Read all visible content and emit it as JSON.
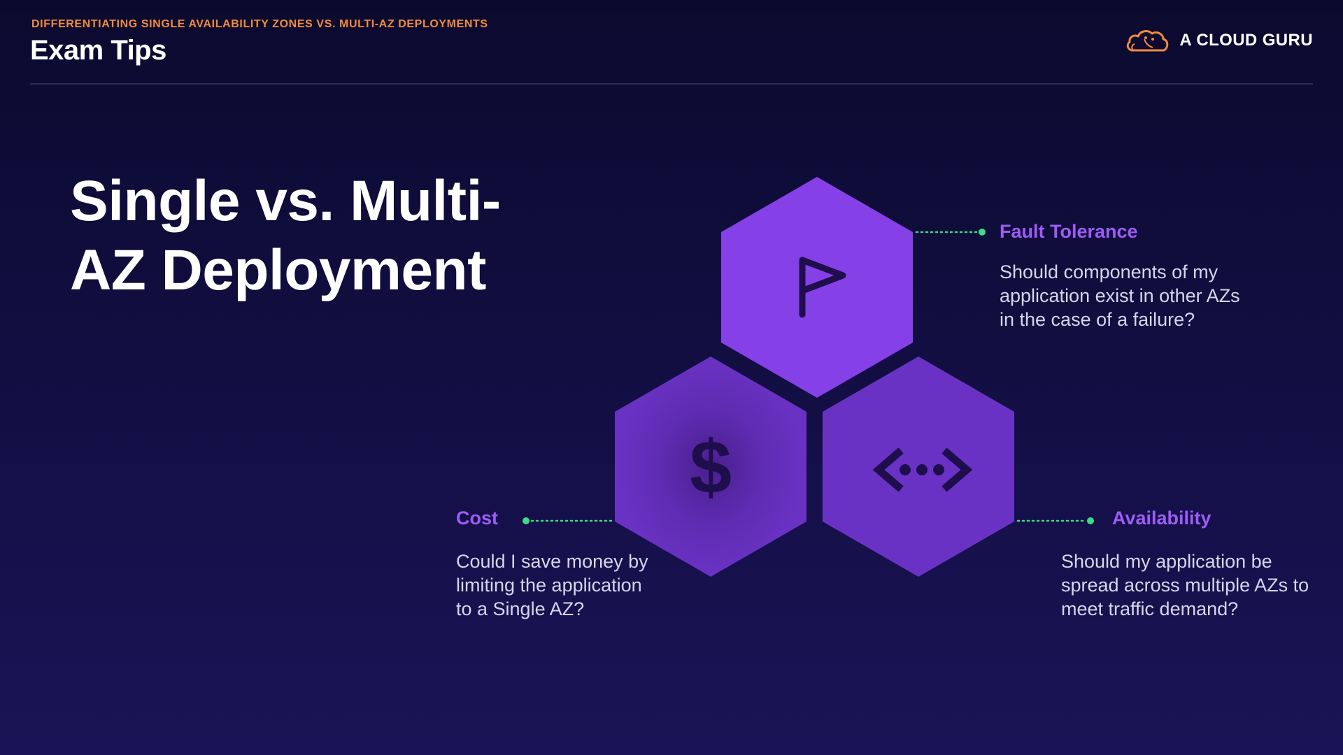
{
  "header": {
    "eyebrow": "DIFFERENTIATING SINGLE AVAILABILITY ZONES VS. MULTI-AZ DEPLOYMENTS",
    "title": "Exam Tips"
  },
  "brand": {
    "name": "A CLOUD GURU",
    "logo_icon": "cloud-logo-icon",
    "logo_color": "#f28c38"
  },
  "main": {
    "title": "Single vs. Multi-AZ Deployment"
  },
  "diagram": {
    "nodes": [
      {
        "id": "fault-tolerance",
        "icon": "flag-icon",
        "color": "#8540e8",
        "label": "Fault Tolerance",
        "text": "Should components of my application exist in other AZs in the case of a failure?"
      },
      {
        "id": "cost",
        "icon": "dollar-icon",
        "color": "#6a32c4",
        "label": "Cost",
        "text": "Could I save money by limiting the application to a Single AZ?"
      },
      {
        "id": "availability",
        "icon": "network-icon",
        "color": "#6a32c4",
        "label": "Availability",
        "text": "Should my application be spread across multiple AZs to meet traffic demand?"
      }
    ],
    "connector_color": "#3ddc84",
    "label_color": "#9d5cf5"
  }
}
